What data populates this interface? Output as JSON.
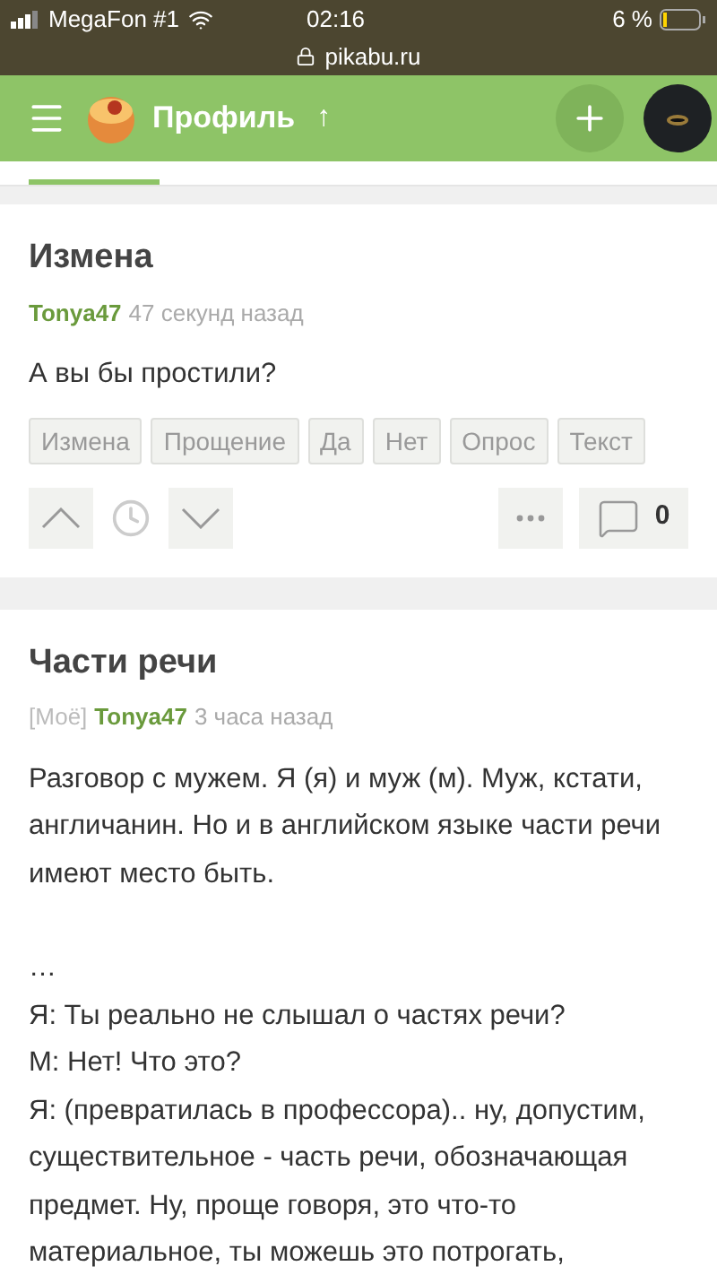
{
  "status_bar": {
    "carrier": "MegaFon #1",
    "time": "02:16",
    "battery": "6 %",
    "url": "pikabu.ru"
  },
  "header": {
    "title": "Профиль",
    "arrow": "↑"
  },
  "posts": [
    {
      "title": "Измена",
      "author": "Tonya47",
      "time": "47 секунд назад",
      "paragraphs": [
        [
          "А вы бы простили?"
        ]
      ],
      "tags": [
        "Измена",
        "Прощение",
        "Да",
        "Нет",
        "Опрос",
        "Текст"
      ],
      "comments": "0"
    },
    {
      "title": "Части речи",
      "mine_tag": "[Моё]",
      "author": "Tonya47",
      "time": "3 часа назад",
      "paragraphs": [
        [
          "Разговор с мужем. Я (я) и муж (м). Муж, кстати, англичанин. Но и в английском языке части речи имеют место быть."
        ],
        [
          "…",
          "Я: Ты реально не слышал о частях речи?",
          "М: Нет! Что это?",
          "Я: (превратилась в профессора).. ну, допустим, существительное - часть речи, обозначающая предмет. Ну, проще говоря, это что-то материальное, ты можешь это потрогать,"
        ]
      ]
    }
  ]
}
